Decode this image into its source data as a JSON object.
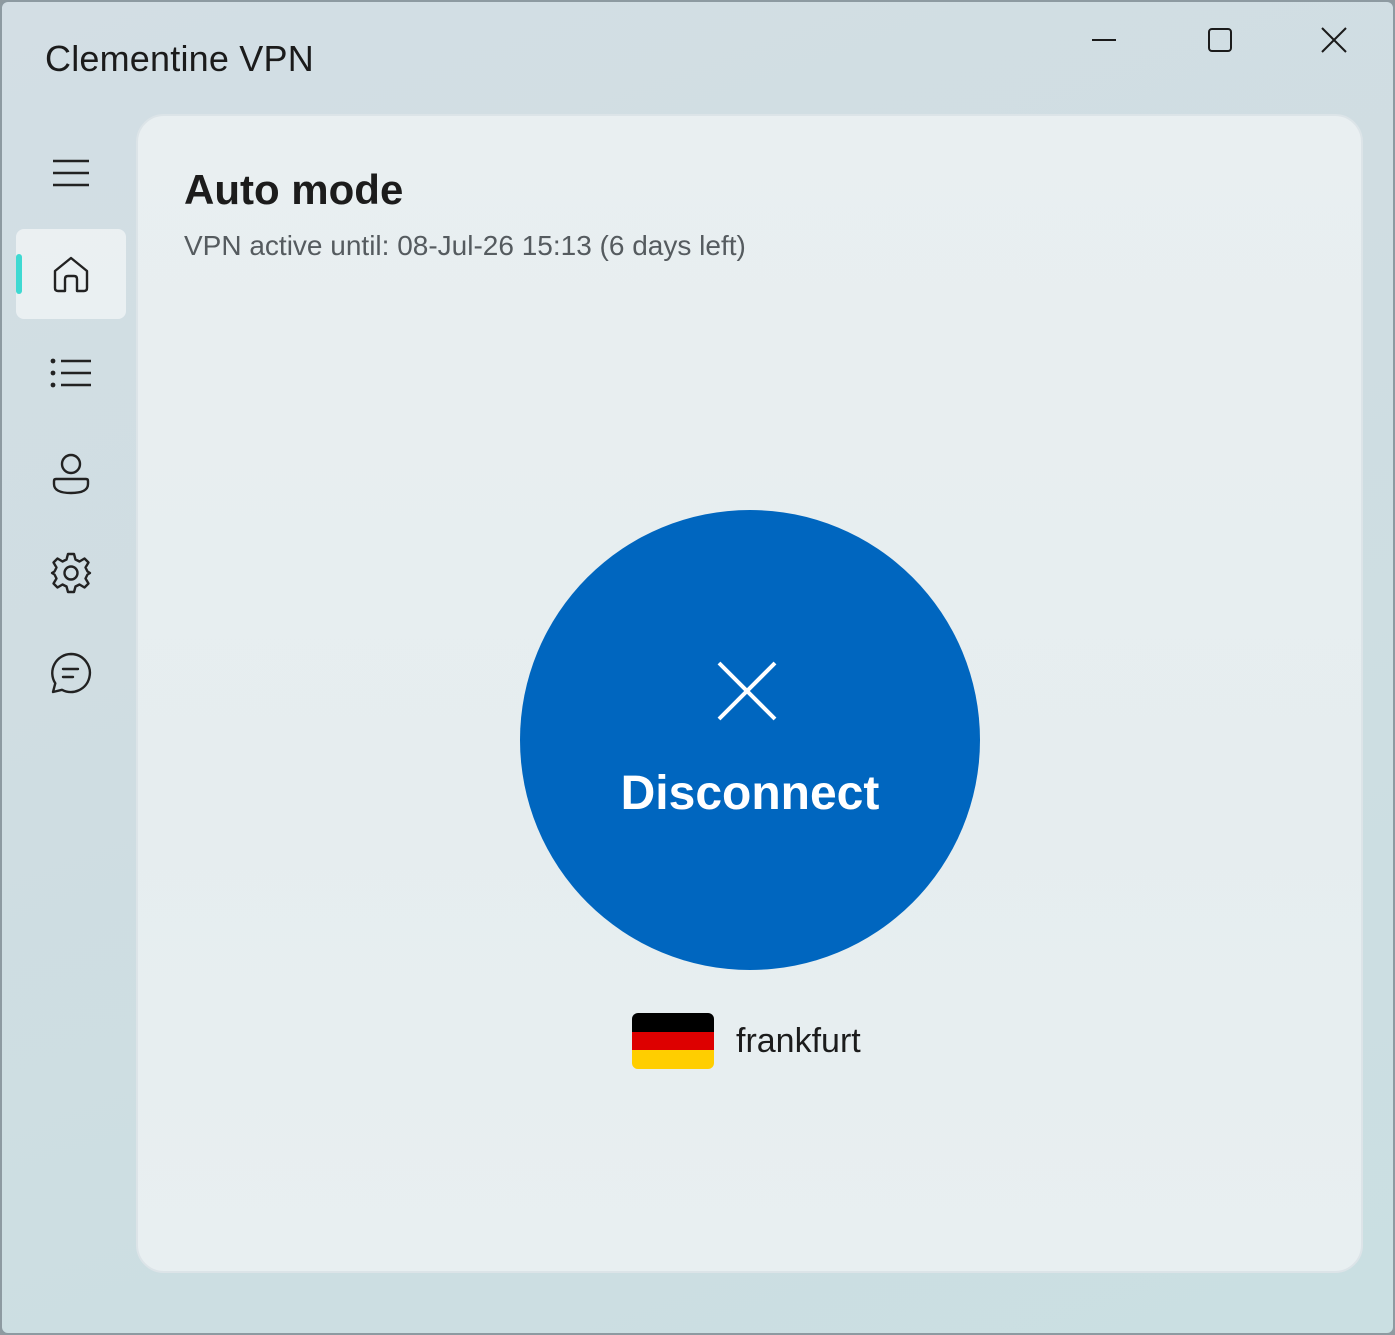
{
  "window": {
    "title": "Clementine VPN",
    "controls": {
      "minimize_icon": "minimize-icon",
      "maximize_icon": "maximize-icon",
      "close_icon": "close-icon"
    }
  },
  "nav": {
    "items": [
      {
        "id": "menu",
        "icon": "hamburger-menu-icon",
        "active": false
      },
      {
        "id": "home",
        "icon": "home-icon",
        "active": true
      },
      {
        "id": "servers",
        "icon": "list-icon",
        "active": false
      },
      {
        "id": "account",
        "icon": "person-icon",
        "active": false
      },
      {
        "id": "settings",
        "icon": "gear-icon",
        "active": false
      },
      {
        "id": "feedback",
        "icon": "chat-bubble-icon",
        "active": false
      }
    ],
    "accent_color": "#3fd9d2"
  },
  "main": {
    "title": "Auto mode",
    "subtitle": "VPN active until: 08-Jul-26 15:13 (6 days left)",
    "connect_button": {
      "label": "Disconnect",
      "icon": "x-icon",
      "color": "#0066bf"
    },
    "location": {
      "name": "frankfurt",
      "flag": "germany-flag",
      "flag_colors": [
        "#000000",
        "#dd0000",
        "#ffce00"
      ]
    }
  }
}
